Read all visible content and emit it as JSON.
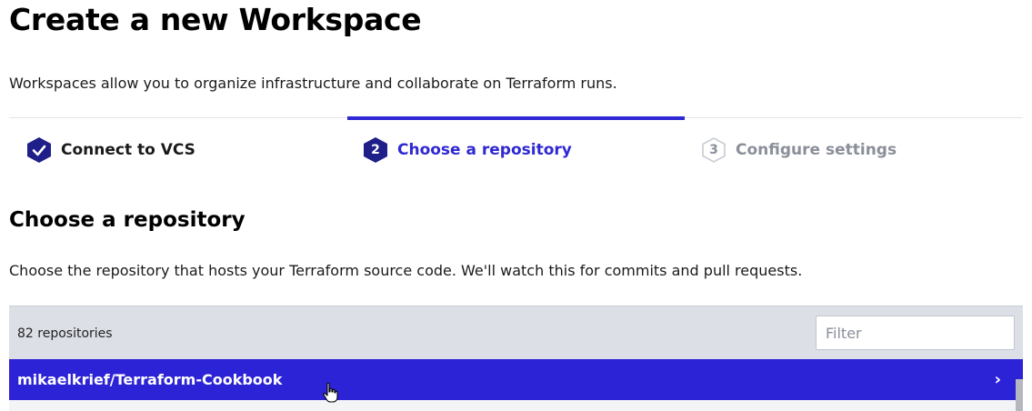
{
  "page": {
    "title": "Create a new Workspace",
    "intro": "Workspaces allow you to organize infrastructure and collaborate on Terraform runs."
  },
  "steps": [
    {
      "number": "1",
      "label": "Connect to VCS",
      "state": "complete",
      "icon": "check-icon"
    },
    {
      "number": "2",
      "label": "Choose a repository",
      "state": "active"
    },
    {
      "number": "3",
      "label": "Configure settings",
      "state": "pending"
    }
  ],
  "section": {
    "title": "Choose a repository",
    "description": "Choose the repository that hosts your Terraform source code. We'll watch this for commits and pull requests."
  },
  "repositories": {
    "count_label": "82 repositories",
    "filter_placeholder": "Filter",
    "items": [
      {
        "name": "mikaelkrief/Terraform-Cookbook",
        "highlighted": true
      }
    ]
  },
  "colors": {
    "accent": "#2f28d3",
    "highlight_row": "#2c22d6",
    "complete_step": "#1f1f8a",
    "pending_step": "#8a8f99"
  }
}
